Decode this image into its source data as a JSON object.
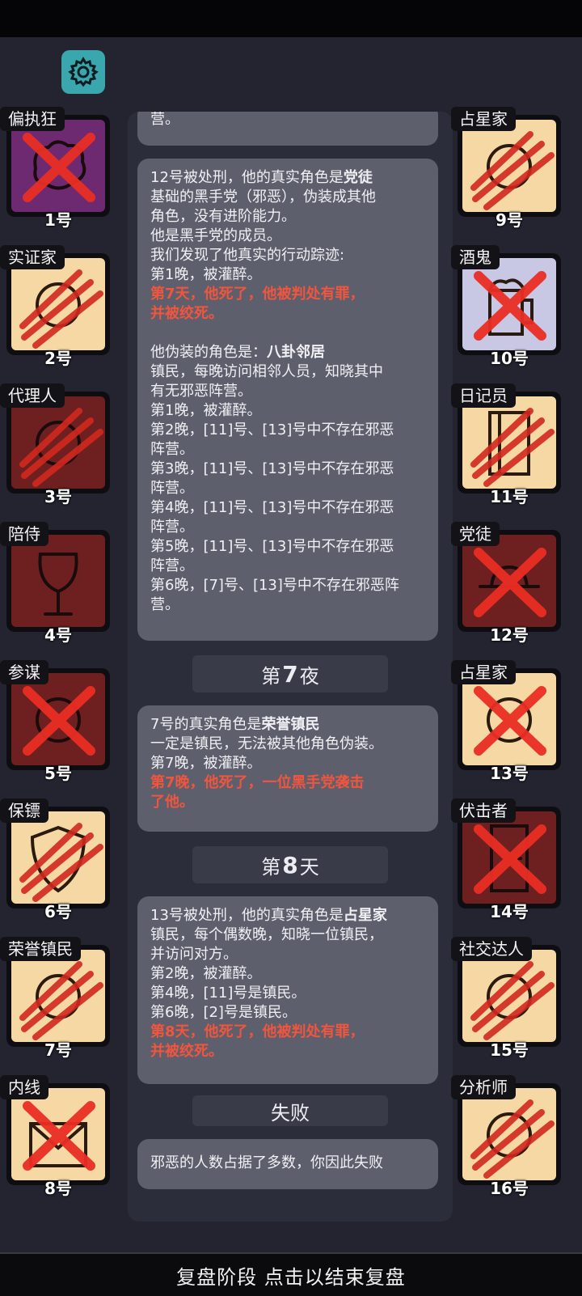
{
  "bottom_bar": {
    "label": "复盘阶段 点击以结束复盘"
  },
  "icons": {
    "settings": "gear-icon"
  },
  "colors": {
    "evil_red": "#f2553d",
    "tile_good": "#f6d8a4",
    "tile_evil": "#6e2020",
    "tile_drunk": "#c9c8e4",
    "tile_mad": "#6e2a70"
  },
  "players_left": [
    {
      "role": "偏执狂",
      "seat": "1号"
    },
    {
      "role": "实证家",
      "seat": "2号"
    },
    {
      "role": "代理人",
      "seat": "3号"
    },
    {
      "role": "陪侍",
      "seat": "4号"
    },
    {
      "role": "参谋",
      "seat": "5号"
    },
    {
      "role": "保镖",
      "seat": "6号"
    },
    {
      "role": "荣誉镇民",
      "seat": "7号"
    },
    {
      "role": "内线",
      "seat": "8号"
    }
  ],
  "players_right": [
    {
      "role": "占星家",
      "seat": "9号"
    },
    {
      "role": "酒鬼",
      "seat": "10号"
    },
    {
      "role": "日记员",
      "seat": "11号"
    },
    {
      "role": "党徒",
      "seat": "12号"
    },
    {
      "role": "占星家",
      "seat": "13号"
    },
    {
      "role": "伏击者",
      "seat": "14号"
    },
    {
      "role": "社交达人",
      "seat": "15号"
    },
    {
      "role": "分析师",
      "seat": "16号"
    }
  ],
  "log": {
    "top_fragment": "营。",
    "card1": {
      "l1_pre": "12号被处刑，他的真实角色是",
      "l1_bold": "党徒",
      "l2": "基础的黑手党（邪恶），伪装成其他",
      "l3": "角色，没有进阶能力。",
      "l4": "他是黑手党的成员。",
      "l5": "我们发现了他真实的行动踪迹:",
      "l6": "第1晚，被灌醉。",
      "r1": "第7天，他死了，他被判处有罪，",
      "r2": "并被绞死。",
      "l8_pre": "他伪装的角色是：",
      "l8_bold": "八卦邻居",
      "l9": "镇民，每晚访问相邻人员，知晓其中",
      "l10": "有无邪恶阵营。",
      "l11": "第1晚，被灌醉。",
      "l12": "第2晚，[11]号、[13]号中不存在邪恶",
      "l13": "阵营。",
      "l14": "第3晚，[11]号、[13]号中不存在邪恶",
      "l15": "阵营。",
      "l16": "第4晚，[11]号、[13]号中不存在邪恶",
      "l17": "阵营。",
      "l18": "第5晚，[11]号、[13]号中不存在邪恶",
      "l19": "阵营。",
      "l20": "第6晚，[7]号、[13]号中不存在邪恶阵",
      "l21": "营。"
    },
    "phase1": {
      "pre": "第",
      "num": "7",
      "post": "夜"
    },
    "card2": {
      "l1_pre": "7号的真实角色是",
      "l1_bold": "荣誉镇民",
      "l2": "一定是镇民，无法被其他角色伪装。",
      "l3": "第7晚，被灌醉。",
      "r1": "第7晚，他死了，一位黑手党袭击",
      "r2": "了他。"
    },
    "phase2": {
      "pre": "第",
      "num": "8",
      "post": "天"
    },
    "card3": {
      "l1_pre": "13号被处刑，他的真实角色是",
      "l1_bold": "占星家",
      "l2": "镇民，每个偶数晚，知晓一位镇民，",
      "l3": "并访问对方。",
      "l4": "第2晚，被灌醉。",
      "l5": "第4晚，[11]号是镇民。",
      "l6": "第6晚，[2]号是镇民。",
      "r1": "第8天，他死了，他被判处有罪，",
      "r2": "并被绞死。"
    },
    "phase3": {
      "label": "失败"
    },
    "card4": {
      "l1": "邪恶的人数占据了多数，你因此失败"
    }
  }
}
